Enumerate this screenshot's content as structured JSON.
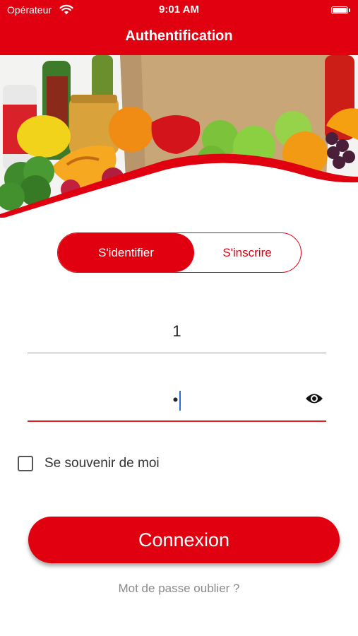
{
  "status_bar": {
    "carrier": "Opérateur",
    "time": "9:01 AM"
  },
  "header": {
    "title": "Authentification"
  },
  "tabs": {
    "login": "S'identifier",
    "signup": "S'inscrire",
    "active": "login"
  },
  "form": {
    "username_value": "1",
    "password_value": "•"
  },
  "remember": {
    "label": "Se souvenir de moi",
    "checked": false
  },
  "actions": {
    "connect": "Connexion",
    "forgot": "Mot de passe oublier ?"
  },
  "colors": {
    "primary": "#e0000f",
    "text_muted": "#8a8a8a"
  },
  "icons": {
    "wifi": "wifi-icon",
    "battery": "battery-icon",
    "eye": "eye-icon"
  }
}
